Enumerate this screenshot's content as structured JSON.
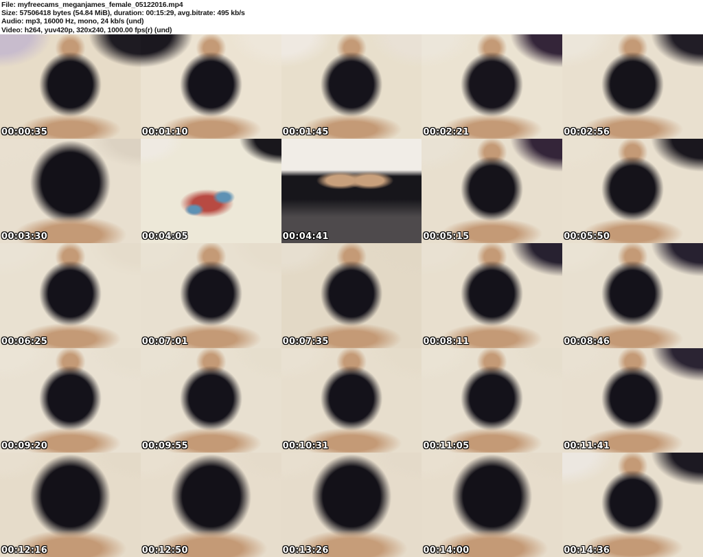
{
  "header": {
    "background": "#ffffff",
    "text_color": "#161616",
    "lines": [
      {
        "label": "File:",
        "value": "myfreecams_meganjames_female_05122016.mp4"
      },
      {
        "label": "Size:",
        "value": "57506418 bytes (54.84 MiB), duration: 00:15:29, avg.bitrate: 495 kb/s"
      },
      {
        "label": "Audio:",
        "value": "mp3, 16000 Hz, mono, 24 kb/s (und)"
      },
      {
        "label": "Video:",
        "value": "h264, yuv420p, 320x240, 1000.00 fps(r) (und)"
      }
    ]
  },
  "grid": {
    "timestamp_color": "#ffffff",
    "timestamp_outline_color": "#000000",
    "thumbnails": [
      {
        "time": "00:00:35",
        "variant": "figure",
        "colors": {
          "bg": "#e7dcc8",
          "fig": "#141219",
          "tl": "#c8bccd",
          "tr": "#1e1b22",
          "skin": "#c49a76"
        }
      },
      {
        "time": "00:01:10",
        "variant": "figure",
        "colors": {
          "bg": "#ece3d2",
          "fig": "#14121a",
          "tl": "#1b181f",
          "tr": "#eee7da",
          "skin": "#c49a76"
        }
      },
      {
        "time": "00:01:45",
        "variant": "figure",
        "colors": {
          "bg": "#e8dfcc",
          "fig": "#15131b",
          "tl": "#efe9e1",
          "tr": "#e9e1d5",
          "skin": "#c49a76"
        }
      },
      {
        "time": "00:02:21",
        "variant": "figure",
        "colors": {
          "bg": "#ebe3d2",
          "fig": "#17141c",
          "tl": "#ece6da",
          "tr": "#342539",
          "skin": "#c49a76"
        }
      },
      {
        "time": "00:02:56",
        "variant": "figure",
        "colors": {
          "bg": "#e9e0cf",
          "fig": "#15131a",
          "tl": "#ece6da",
          "tr": "#211d26",
          "skin": "#c49a76"
        }
      },
      {
        "time": "00:03:30",
        "variant": "closeup",
        "colors": {
          "bg": "#e8dfcf",
          "fig": "#131118",
          "tl": "#e9e0d0",
          "tr": "#dcd2c2",
          "skin": "#c49a76"
        }
      },
      {
        "time": "00:04:05",
        "variant": "pillow",
        "colors": {
          "bg": "#ede8d8",
          "fig": "#b84a42",
          "tl": "#efeae2",
          "tr": "#19171c",
          "skin": "#c49a76",
          "blue": "#5d91b4"
        }
      },
      {
        "time": "00:04:41",
        "variant": "keyboard",
        "colors": {
          "bg": "#4e4a4c",
          "fig": "#17161b",
          "tl": "#f1ede7",
          "tr": "#f1ede7",
          "skin": "#c8a07c"
        }
      },
      {
        "time": "00:05:15",
        "variant": "figure",
        "colors": {
          "bg": "#e8dfce",
          "fig": "#15131a",
          "tl": "#e9e2d4",
          "tr": "#342539",
          "skin": "#c49a76"
        }
      },
      {
        "time": "00:05:50",
        "variant": "figure",
        "colors": {
          "bg": "#e9e0cf",
          "fig": "#15131a",
          "tl": "#eae2d2",
          "tr": "#1a171e",
          "skin": "#c49a76"
        }
      },
      {
        "time": "00:06:25",
        "variant": "figure",
        "colors": {
          "bg": "#e9e1d1",
          "fig": "#14121a",
          "tl": "#eae3d5",
          "tr": "#e5dccb",
          "skin": "#c49a76"
        }
      },
      {
        "time": "00:07:01",
        "variant": "figure",
        "colors": {
          "bg": "#e8e0d0",
          "fig": "#14121a",
          "tl": "#e9e2d3",
          "tr": "#e6ddcc",
          "skin": "#c49a76"
        }
      },
      {
        "time": "00:07:35",
        "variant": "figure",
        "colors": {
          "bg": "#e3d9c6",
          "fig": "#14121a",
          "tl": "#e7dfd0",
          "tr": "#e2d8c5",
          "skin": "#c49a76"
        }
      },
      {
        "time": "00:08:11",
        "variant": "figure",
        "colors": {
          "bg": "#e8dfce",
          "fig": "#14121a",
          "tl": "#e9e1d2",
          "tr": "#272130",
          "skin": "#c49a76"
        }
      },
      {
        "time": "00:08:46",
        "variant": "figure",
        "colors": {
          "bg": "#e8e0d0",
          "fig": "#14121a",
          "tl": "#eae3d4",
          "tr": "#272130",
          "skin": "#c49a76"
        }
      },
      {
        "time": "00:09:20",
        "variant": "figure",
        "colors": {
          "bg": "#e9e1d2",
          "fig": "#14121a",
          "tl": "#ebe4d6",
          "tr": "#e7dfcf",
          "skin": "#c49a76"
        }
      },
      {
        "time": "00:09:55",
        "variant": "figure",
        "colors": {
          "bg": "#e8e0d0",
          "fig": "#14121a",
          "tl": "#e9e2d3",
          "tr": "#e6decd",
          "skin": "#c49a76"
        }
      },
      {
        "time": "00:10:31",
        "variant": "figure",
        "colors": {
          "bg": "#e7decd",
          "fig": "#14121a",
          "tl": "#e9e1d2",
          "tr": "#e5dcca",
          "skin": "#c49a76"
        }
      },
      {
        "time": "00:11:05",
        "variant": "figure",
        "colors": {
          "bg": "#e8e0d0",
          "fig": "#14121a",
          "tl": "#eae3d4",
          "tr": "#e6decd",
          "skin": "#c49a76"
        }
      },
      {
        "time": "00:11:41",
        "variant": "figure",
        "colors": {
          "bg": "#e8dfcf",
          "fig": "#14121a",
          "tl": "#e9e1d2",
          "tr": "#2b2433",
          "skin": "#c49a76"
        }
      },
      {
        "time": "00:12:16",
        "variant": "closeup",
        "colors": {
          "bg": "#e6dcca",
          "fig": "#131118",
          "tl": "#e8dfcf",
          "tr": "#e4dac8",
          "skin": "#c49a76"
        }
      },
      {
        "time": "00:12:50",
        "variant": "closeup",
        "colors": {
          "bg": "#e7ddcc",
          "fig": "#131118",
          "tl": "#e9e0d0",
          "tr": "#e5dbca",
          "skin": "#c49a76"
        }
      },
      {
        "time": "00:13:26",
        "variant": "closeup",
        "colors": {
          "bg": "#e6dccb",
          "fig": "#131118",
          "tl": "#e8dfcf",
          "tr": "#e4dac9",
          "skin": "#c69d79"
        }
      },
      {
        "time": "00:14:00",
        "variant": "closeup",
        "colors": {
          "bg": "#e7ddcc",
          "fig": "#131118",
          "tl": "#e9e0d0",
          "tr": "#e5dbca",
          "skin": "#c49a76"
        }
      },
      {
        "time": "00:14:36",
        "variant": "figure",
        "colors": {
          "bg": "#e8dfce",
          "fig": "#14121a",
          "tl": "#ece7e0",
          "tr": "#1c1922",
          "skin": "#c49a76"
        }
      }
    ]
  }
}
